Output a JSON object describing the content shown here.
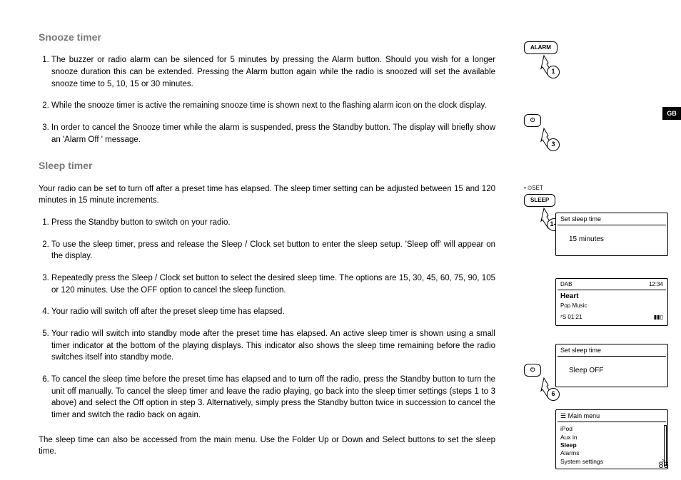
{
  "tab": "GB",
  "pageNumber": "86",
  "section1": {
    "title": "Snooze timer",
    "items": [
      "The buzzer or radio alarm can be silenced for 5 minutes by pressing the Alarm button. Should you wish for a longer snooze duration this can be extended. Pressing the Alarm button again while the radio is snoozed will set the available snooze time to 5, 10, 15 or 30 minutes.",
      "While the snooze timer is active the remaining snooze time is shown next to the flashing alarm icon on the clock display.",
      "In order to cancel the Snooze timer while the alarm is suspended, press the Standby button. The display will briefly show an 'Alarm Off '  message."
    ]
  },
  "section2": {
    "title": "Sleep timer",
    "intro": "Your radio can be set to turn off after a preset time has elapsed. The sleep timer setting can be adjusted between 15 and 120 minutes in 15 minute increments.",
    "items": [
      "Press the Standby button to switch on your radio.",
      "To use the sleep timer, press and release the Sleep / Clock set button to enter the sleep setup. 'Sleep off' will appear on the display.",
      "Repeatedly press the Sleep / Clock set button to select the desired sleep time. The options are 15, 30, 45, 60, 75, 90, 105 or 120 minutes. Use the OFF option to cancel the sleep function.",
      "Your radio will switch off after the preset sleep time has elapsed.",
      "Your radio will switch into standby mode after the preset time has elapsed. An active sleep timer is shown using a small timer indicator at the bottom of the playing displays. This indicator also shows the sleep time remaining before the radio switches itself into standby mode.",
      "To cancel the sleep time before the preset time has elapsed and to turn off the radio, press the Standby button to turn the unit off manually. To cancel the sleep timer and leave the radio playing, go back into the sleep timer settings (steps 1 to 3 above) and select the Off option in step 3. Alternatively, simply press the Standby button twice in succession to cancel the timer and switch the radio back on again."
    ],
    "outro": "The sleep time can also be accessed from the main menu. Use the Folder Up or Down and Select buttons to set the sleep time."
  },
  "buttons": {
    "alarm": {
      "label": "ALARM",
      "step": "1"
    },
    "standby1": {
      "label": "⏻",
      "step": "3"
    },
    "sleep": {
      "label": "SLEEP",
      "over": "• ⏲SET",
      "step": "1-3"
    },
    "standby2": {
      "label": "⏻",
      "step": "6"
    }
  },
  "screens": {
    "s1": {
      "title": "Set sleep time",
      "body": "15  minutes"
    },
    "s2": {
      "mode": "DAB",
      "time": "12:34",
      "station": "Heart",
      "genre": "Pop Music",
      "sleepRemain": "ᶻS 01:21",
      "sig": "▮▮▯"
    },
    "s3": {
      "title": "Set sleep time",
      "body": "Sleep  OFF"
    },
    "s4": {
      "title": "☰ Main menu",
      "items": [
        "iPod",
        "Aux in",
        "Sleep",
        "Alarms",
        "System settings"
      ],
      "selected": 2,
      "marker": ">"
    }
  }
}
